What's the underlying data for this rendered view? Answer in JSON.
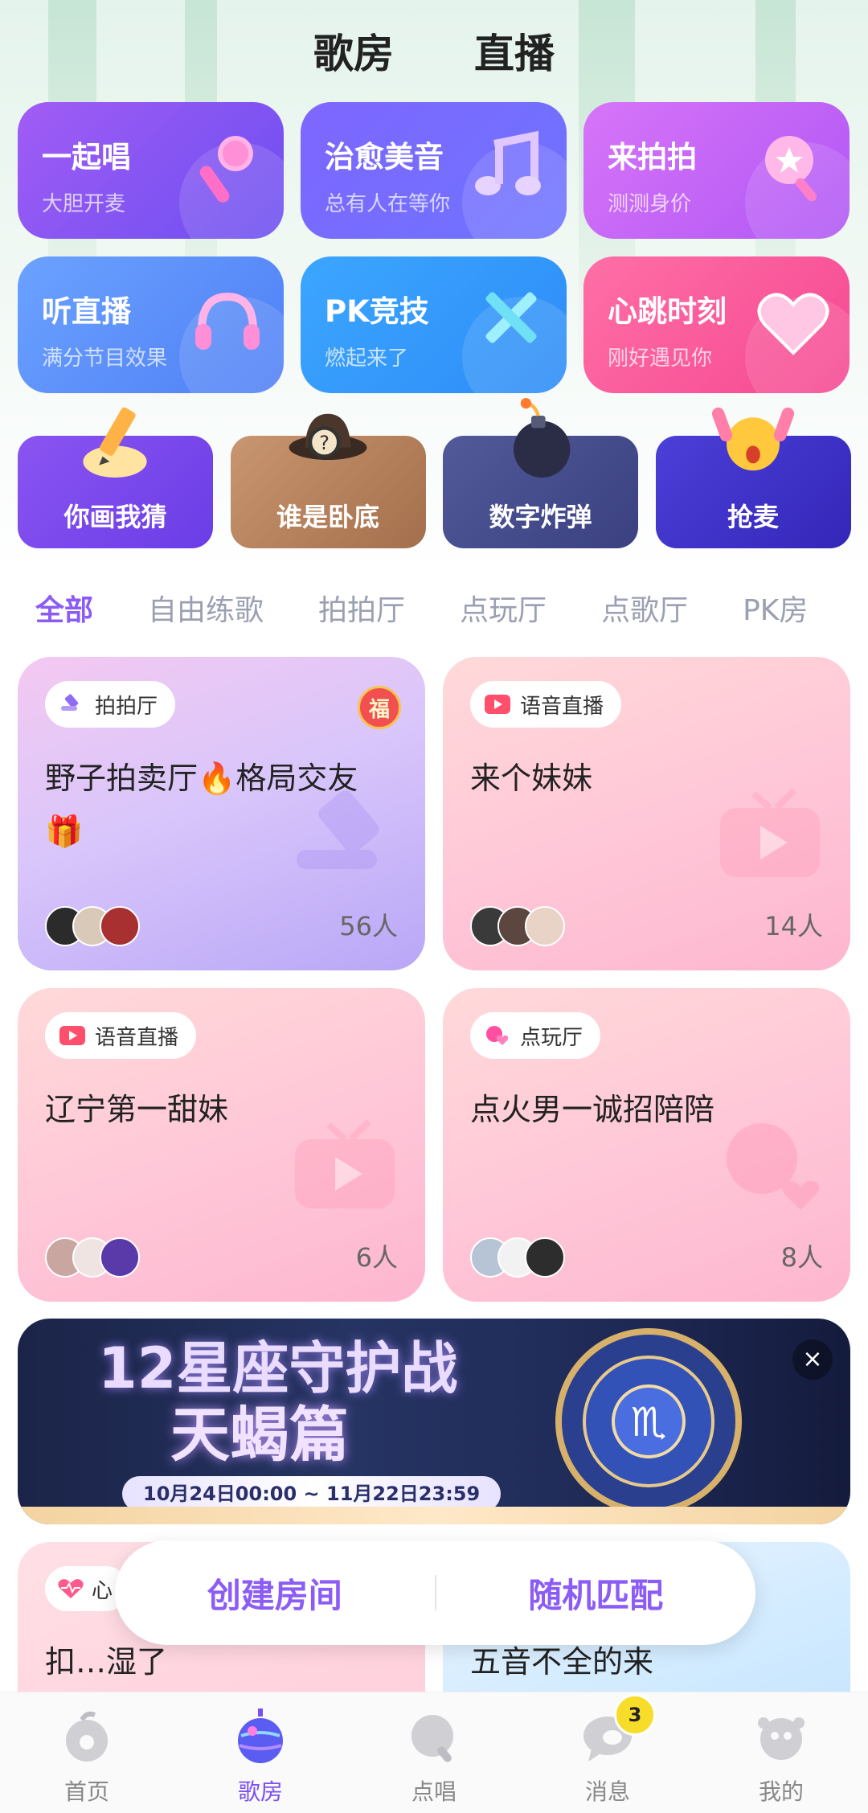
{
  "top_tabs": [
    {
      "label": "歌房",
      "active": true
    },
    {
      "label": "直播",
      "active": false
    }
  ],
  "feature_cards": [
    {
      "title": "一起唱",
      "subtitle": "大胆开麦",
      "icon": "microphone-icon"
    },
    {
      "title": "治愈美音",
      "subtitle": "总有人在等你",
      "icon": "music-note-icon"
    },
    {
      "title": "来拍拍",
      "subtitle": "测测身价",
      "icon": "paddle-icon"
    },
    {
      "title": "听直播",
      "subtitle": "满分节目效果",
      "icon": "headphones-icon"
    },
    {
      "title": "PK竞技",
      "subtitle": "燃起来了",
      "icon": "crossed-swords-icon"
    },
    {
      "title": "心跳时刻",
      "subtitle": "刚好遇见你",
      "icon": "heart-icon"
    }
  ],
  "games": [
    {
      "label": "你画我猜",
      "icon": "pencil-icon"
    },
    {
      "label": "谁是卧底",
      "icon": "detective-hat-icon"
    },
    {
      "label": "数字炸弹",
      "icon": "bomb-icon"
    },
    {
      "label": "抢麦",
      "icon": "cheering-face-icon"
    }
  ],
  "category_tabs": [
    {
      "label": "全部",
      "active": true
    },
    {
      "label": "自由练歌",
      "active": false
    },
    {
      "label": "拍拍厅",
      "active": false
    },
    {
      "label": "点玩厅",
      "active": false
    },
    {
      "label": "点歌厅",
      "active": false
    },
    {
      "label": "PK房",
      "active": false
    }
  ],
  "rooms": [
    {
      "tag": "拍拍厅",
      "tag_icon": "gavel-icon",
      "title": "野子拍卖厅🔥格局交友",
      "title_line2": "🎁",
      "count": "56人",
      "badge": "福",
      "style": "purple"
    },
    {
      "tag": "语音直播",
      "tag_icon": "play-icon",
      "title": "来个妹妹",
      "title_line2": "",
      "count": "14人",
      "badge": "",
      "style": "pink"
    },
    {
      "tag": "语音直播",
      "tag_icon": "play-icon",
      "title": "辽宁第一甜妹",
      "title_line2": "",
      "count": "6人",
      "badge": "",
      "style": "pink"
    },
    {
      "tag": "点玩厅",
      "tag_icon": "chat-heart-icon",
      "title": "点火男一诚招陪陪",
      "title_line2": "",
      "count": "8人",
      "badge": "",
      "style": "pink"
    }
  ],
  "banner": {
    "title": "12星座守护战",
    "subtitle": "天蝎篇",
    "date_range": "10月24日00:00 ~ 11月22日23:59",
    "close": "×"
  },
  "partial_rooms": [
    {
      "tag": "心",
      "title": "扣…湿了"
    },
    {
      "tag": "",
      "title": "五音不全的来"
    }
  ],
  "actions": {
    "create_room": "创建房间",
    "random_match": "随机匹配"
  },
  "bottom_nav": [
    {
      "label": "首页",
      "icon": "home-icon",
      "active": false,
      "badge": ""
    },
    {
      "label": "歌房",
      "icon": "disco-ball-icon",
      "active": true,
      "badge": ""
    },
    {
      "label": "点唱",
      "icon": "request-song-icon",
      "active": false,
      "badge": ""
    },
    {
      "label": "消息",
      "icon": "message-icon",
      "active": false,
      "badge": "3"
    },
    {
      "label": "我的",
      "icon": "profile-icon",
      "active": false,
      "badge": ""
    }
  ],
  "colors": {
    "accent": "#8b5cf6",
    "active_tab_underline": "#f7e93b",
    "badge_yellow": "#f7dc2a"
  }
}
